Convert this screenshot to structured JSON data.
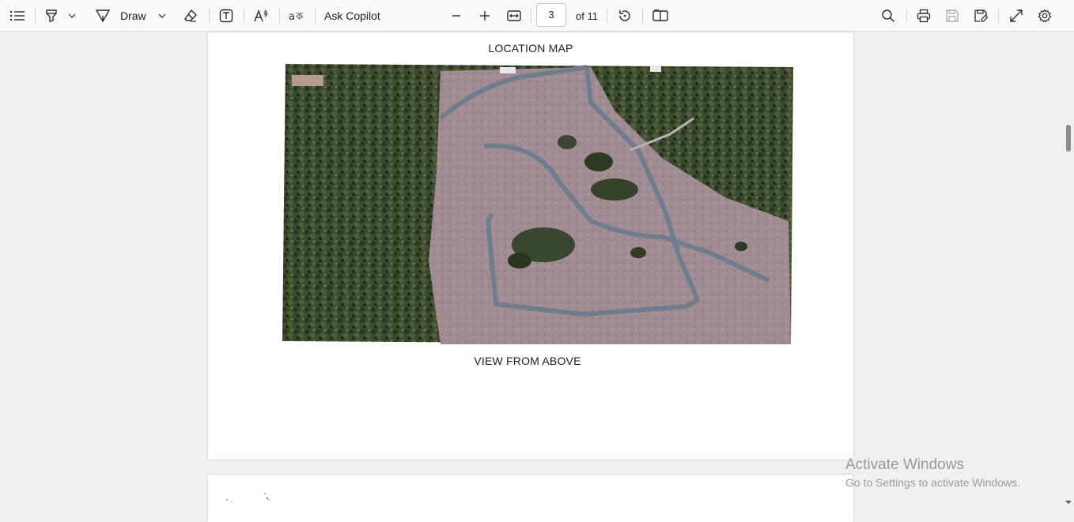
{
  "toolbar": {
    "draw_label": "Draw",
    "ask_copilot_label": "Ask Copilot",
    "page_number": "3",
    "page_count": "of 11"
  },
  "document": {
    "caption_top": "LOCATION MAP",
    "caption_bottom": "VIEW FROM ABOVE"
  },
  "watermark": {
    "title": "Activate Windows",
    "subtitle": "Go to Settings to activate Windows."
  },
  "colors": {
    "toolbar_bg": "#f9f9f9",
    "canvas_bg": "#f0f0f0",
    "page_bg": "#ffffff",
    "icon": "#2b2b2b"
  }
}
